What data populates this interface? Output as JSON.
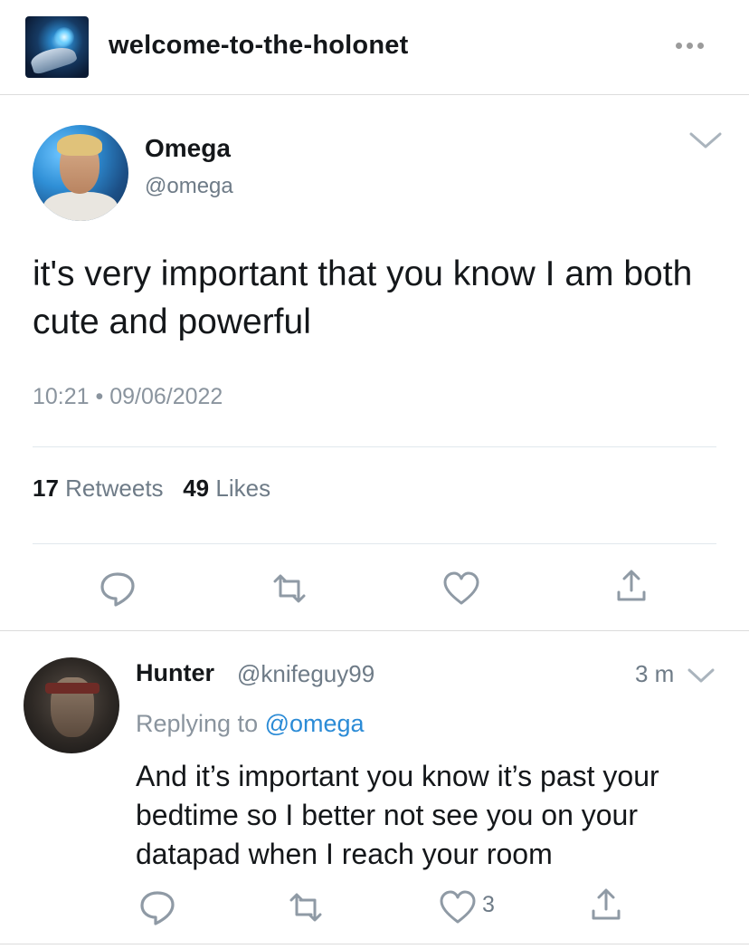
{
  "header": {
    "blog_name": "welcome-to-the-holonet",
    "blog_avatar_icon": "holonet-avatar-icon",
    "more_icon": "more-options-icon"
  },
  "tweet": {
    "author_name": "Omega",
    "author_handle": "@omega",
    "text": "it's very important that you know I am both cute and powerful",
    "time": "10:21 • 09/06/2022",
    "retweets_count": "17",
    "retweets_label": "Retweets",
    "likes_count": "49",
    "likes_label": "Likes",
    "actions": [
      "reply-icon",
      "retweet-icon",
      "like-icon",
      "share-icon"
    ]
  },
  "reply": {
    "author_name": "Hunter",
    "author_handle": "@knifeguy99",
    "time": "3 m",
    "replying_prefix": "Replying to",
    "replying_to": "@omega",
    "text": "And it’s important you know it’s past your bedtime so I better not see you on your datapad when I reach your room",
    "like_count": "3"
  },
  "colors": {
    "text": "#14171a",
    "muted": "#6e7b87",
    "icon": "#8f9aa5",
    "link": "#2b8bd6",
    "divider": "#e1e8ed"
  }
}
